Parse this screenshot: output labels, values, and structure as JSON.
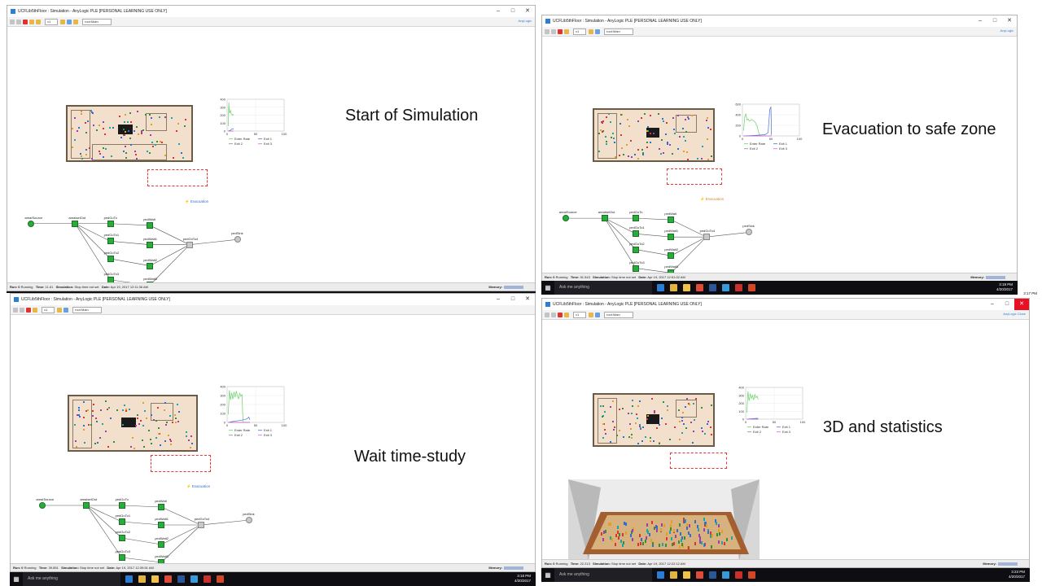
{
  "window": {
    "title": "UCFLib5thFloor : Simulation - AnyLogic PLE [PERSONAL LEARNING USE ONLY]",
    "experiment_combo": "root:Main",
    "speed": "x1",
    "brand": "AnyLogic",
    "brand_close": "AnyLogic Close"
  },
  "panels": [
    {
      "caption": "Start of Simulation",
      "run": "Run: 0",
      "state": "Running",
      "time_label": "Time:",
      "time": "11.61",
      "sim_label": "Simulation:",
      "stop": "Stop time not set",
      "date_label": "Date:",
      "date": "Apr 19, 2017 12:11:36 AM",
      "memory": "Memory:"
    },
    {
      "caption": "Evacuation to safe zone",
      "run": "Run: 0",
      "state": "Running",
      "time_label": "Time:",
      "time": "51.543",
      "sim_label": "Simulation:",
      "stop": "Stop time not set",
      "date_label": "Date:",
      "date": "Apr 19, 2017 12:51:02 AM",
      "memory": "Memory:"
    },
    {
      "caption": "Wait time-study",
      "run": "Run: 0",
      "state": "Running",
      "time_label": "Time:",
      "time": "39.851",
      "sim_label": "Simulation:",
      "stop": "Stop time not set",
      "date_label": "Date:",
      "date": "Apr 19, 2017 12:39:51 AM",
      "memory": "Memory:"
    },
    {
      "caption": "3D and statistics",
      "run": "Run: 0",
      "state": "Running",
      "time_label": "Time:",
      "time": "22.213",
      "sim_label": "Simulation:",
      "stop": "Stop time not set",
      "date_label": "Date:",
      "date": "Apr 19, 2017 12:22:12 AM",
      "memory": "Memory:"
    }
  ],
  "flow": {
    "nodes": [
      "areaISource",
      "areaIselOut",
      "pedGoTo",
      "pedWait",
      "pedGoTo1",
      "pedWait1",
      "pedGoTo2",
      "pedWait2",
      "pedGoTo3",
      "pedWait3",
      "pedGoTo4",
      "pedSink"
    ],
    "evacuation": "Evacuation"
  },
  "chart_legend": [
    "Enter Rate",
    "Exit 1",
    "Exit 2",
    "Exit 3"
  ],
  "chart_data": [
    {
      "type": "line",
      "title": "",
      "xlabel": "",
      "ylabel": "",
      "xlim": [
        0,
        100
      ],
      "ylim": [
        0,
        400
      ],
      "x_ticks": [
        "0",
        "50",
        "100"
      ],
      "y_ticks": [
        "0",
        "100",
        "200",
        "300",
        "400"
      ],
      "series": [
        {
          "name": "Enter Rate",
          "color": "#6bd16b",
          "x": [
            2,
            3,
            4,
            5,
            6,
            7,
            8,
            9,
            10,
            11
          ],
          "values": [
            60,
            360,
            230,
            240,
            260,
            220,
            210,
            200,
            210,
            200
          ]
        },
        {
          "name": "Exit 1",
          "color": "#4a6fd8",
          "x": [
            2,
            4,
            6,
            8,
            10,
            11
          ],
          "values": [
            0,
            5,
            10,
            25,
            30,
            20
          ]
        },
        {
          "name": "Exit 2",
          "color": "#888888",
          "x": [
            2,
            11
          ],
          "values": [
            0,
            0
          ]
        },
        {
          "name": "Exit 3",
          "color": "#d26ad2",
          "x": [
            2,
            11
          ],
          "values": [
            0,
            0
          ]
        }
      ]
    },
    {
      "type": "line",
      "title": "",
      "xlabel": "",
      "ylabel": "",
      "xlim": [
        0,
        100
      ],
      "ylim": [
        0,
        600
      ],
      "x_ticks": [
        "0",
        "50",
        "100"
      ],
      "y_ticks": [
        "0",
        "200",
        "400",
        "600"
      ],
      "series": [
        {
          "name": "Enter Rate",
          "color": "#6bd16b",
          "x": [
            2,
            4,
            6,
            8,
            10,
            12,
            14,
            16,
            18,
            20,
            22,
            24,
            26,
            28,
            30,
            32
          ],
          "values": [
            100,
            350,
            420,
            300,
            320,
            280,
            290,
            310,
            300,
            280,
            270,
            220,
            180,
            80,
            20,
            0
          ]
        },
        {
          "name": "Exit 1",
          "color": "#4a6fd8",
          "x": [
            2,
            10,
            20,
            30,
            40,
            45,
            48,
            50,
            51
          ],
          "values": [
            0,
            5,
            10,
            15,
            25,
            60,
            500,
            550,
            20
          ]
        },
        {
          "name": "Exit 2",
          "color": "#888888",
          "x": [
            2,
            51
          ],
          "values": [
            0,
            0
          ]
        },
        {
          "name": "Exit 3",
          "color": "#d26ad2",
          "x": [
            2,
            51
          ],
          "values": [
            0,
            0
          ]
        }
      ]
    },
    {
      "type": "line",
      "title": "",
      "xlabel": "",
      "ylabel": "",
      "xlim": [
        0,
        100
      ],
      "ylim": [
        0,
        400
      ],
      "x_ticks": [
        "0",
        "50",
        "100"
      ],
      "y_ticks": [
        "0",
        "100",
        "200",
        "300",
        "400"
      ],
      "series": [
        {
          "name": "Enter Rate",
          "color": "#6bd16b",
          "x": [
            2,
            4,
            6,
            8,
            10,
            12,
            14,
            16,
            18,
            20,
            22,
            24,
            26,
            28,
            30,
            32,
            34,
            36,
            38,
            40
          ],
          "values": [
            90,
            360,
            250,
            330,
            260,
            340,
            280,
            350,
            300,
            260,
            330,
            290,
            310,
            0,
            0,
            0,
            0,
            0,
            0,
            0
          ]
        },
        {
          "name": "Exit 1",
          "color": "#4a6fd8",
          "x": [
            2,
            10,
            20,
            30,
            35,
            38,
            40
          ],
          "values": [
            0,
            10,
            20,
            30,
            40,
            60,
            30
          ]
        },
        {
          "name": "Exit 2",
          "color": "#888888",
          "x": [
            2,
            40
          ],
          "values": [
            0,
            0
          ]
        },
        {
          "name": "Exit 3",
          "color": "#d26ad2",
          "x": [
            2,
            40
          ],
          "values": [
            0,
            0
          ]
        }
      ]
    },
    {
      "type": "line",
      "title": "",
      "xlabel": "",
      "ylabel": "",
      "xlim": [
        0,
        100
      ],
      "ylim": [
        0,
        400
      ],
      "x_ticks": [
        "0",
        "50",
        "100"
      ],
      "y_ticks": [
        "0",
        "100",
        "200",
        "300",
        "400"
      ],
      "series": [
        {
          "name": "Enter Rate",
          "color": "#6bd16b",
          "x": [
            2,
            4,
            6,
            8,
            10,
            12,
            14,
            16,
            18,
            20,
            22
          ],
          "values": [
            80,
            350,
            230,
            320,
            260,
            300,
            240,
            310,
            270,
            290,
            250
          ]
        },
        {
          "name": "Exit 1",
          "color": "#4a6fd8",
          "x": [
            2,
            10,
            20,
            22
          ],
          "values": [
            0,
            5,
            10,
            8
          ]
        },
        {
          "name": "Exit 2",
          "color": "#888888",
          "x": [
            2,
            22
          ],
          "values": [
            0,
            0
          ]
        },
        {
          "name": "Exit 3",
          "color": "#d26ad2",
          "x": [
            2,
            22
          ],
          "values": [
            0,
            0
          ]
        }
      ]
    }
  ],
  "taskbar": {
    "search": "Ask me anything",
    "times": [
      "3:17 PM",
      "3:19 PM",
      "3:18 PM",
      "3:23 PM"
    ],
    "date": "4/20/2017"
  }
}
